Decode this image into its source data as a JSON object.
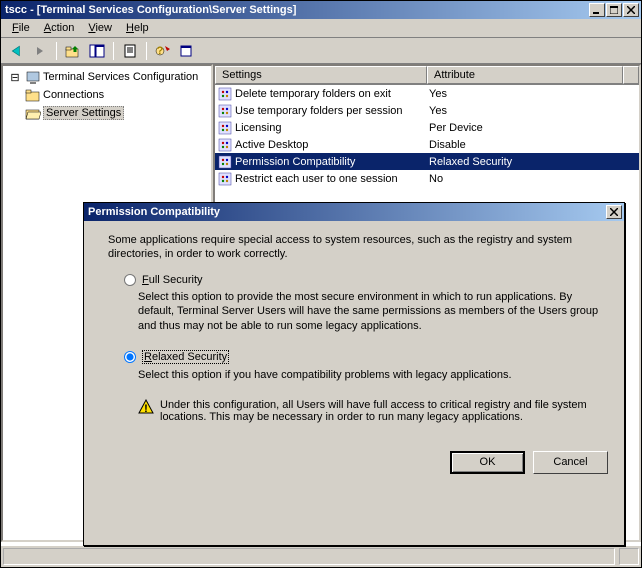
{
  "window": {
    "title": "tscc - [Terminal Services Configuration\\Server Settings]"
  },
  "menu": {
    "file": "File",
    "action": "Action",
    "view": "View",
    "help": "Help"
  },
  "tree": {
    "root": "Terminal Services Configuration",
    "connections": "Connections",
    "server_settings": "Server Settings"
  },
  "list": {
    "col_settings": "Settings",
    "col_attribute": "Attribute",
    "rows": [
      {
        "setting": "Delete temporary folders on exit",
        "attribute": "Yes"
      },
      {
        "setting": "Use temporary folders per session",
        "attribute": "Yes"
      },
      {
        "setting": "Licensing",
        "attribute": "Per Device"
      },
      {
        "setting": "Active Desktop",
        "attribute": "Disable"
      },
      {
        "setting": "Permission Compatibility",
        "attribute": "Relaxed Security"
      },
      {
        "setting": "Restrict each user to one session",
        "attribute": "No"
      }
    ]
  },
  "dialog": {
    "title": "Permission Compatibility",
    "intro": "Some applications require special access to system resources, such as the registry and system directories, in order to work correctly.",
    "full_label": "Full Security",
    "full_desc": "Select this option to provide the most secure environment in which to run applications.  By default, Terminal Server Users will have the same permissions as members of the Users group and thus may not be able to run some legacy applications.",
    "relaxed_label": "Relaxed Security",
    "relaxed_desc": "Select this option if you have compatibility problems with legacy applications.",
    "warning": "Under this configuration, all Users will have full access to critical registry and file system locations. This may be necessary in order to run many legacy applications.",
    "ok": "OK",
    "cancel": "Cancel"
  }
}
